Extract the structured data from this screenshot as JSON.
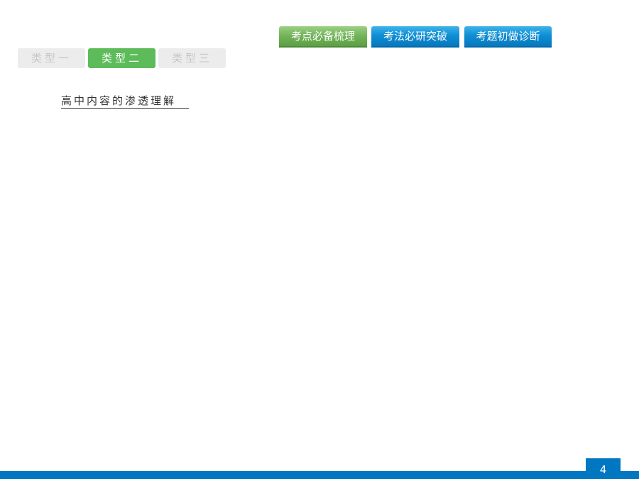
{
  "section_tabs": [
    {
      "label": "考点必备梳理",
      "active": true
    },
    {
      "label": "考法必研突破",
      "active": false
    },
    {
      "label": "考题初做诊断",
      "active": false
    }
  ],
  "type_tabs": [
    {
      "label": "类型一",
      "active": false
    },
    {
      "label": "类型二",
      "active": true
    },
    {
      "label": "类型三",
      "active": false
    }
  ],
  "content": {
    "heading": "高中内容的渗透理解"
  },
  "footer": {
    "page_number": "4"
  },
  "colors": {
    "active_tab_green": "#74b55b",
    "tab_blue": "#0f8fd4",
    "type_active_green": "#5dbb5a",
    "footer_blue": "#0077c0"
  }
}
